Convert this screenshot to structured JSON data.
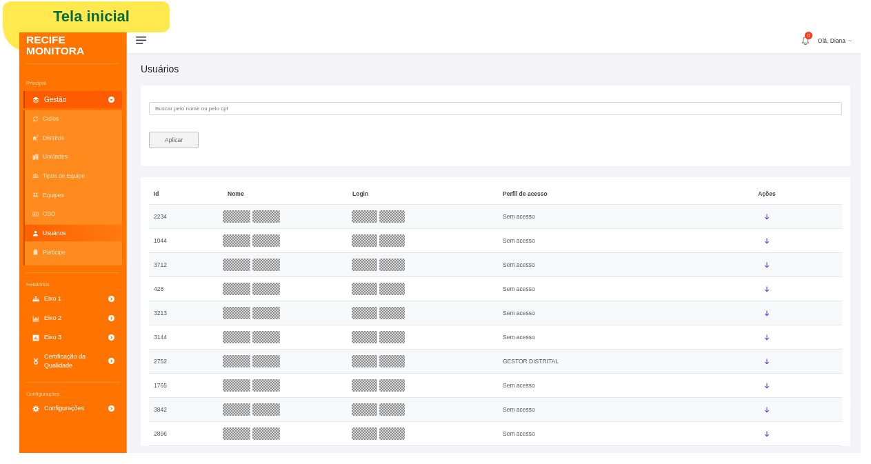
{
  "callout": {
    "text": "Tela inicial"
  },
  "sidebar": {
    "logo": "RECIFE MONITORA",
    "sections": [
      {
        "label": "Principal",
        "items": [
          {
            "label": "Gestão",
            "expanded": true,
            "children": [
              {
                "label": "Ciclos",
                "selected": false
              },
              {
                "label": "Distritos",
                "selected": false
              },
              {
                "label": "Unidades",
                "selected": false
              },
              {
                "label": "Tipos de Equipe",
                "selected": false
              },
              {
                "label": "Equipes",
                "selected": false
              },
              {
                "label": "CBO",
                "selected": false
              },
              {
                "label": "Usuários",
                "selected": true
              },
              {
                "label": "Participe",
                "selected": false
              }
            ]
          }
        ]
      },
      {
        "label": "Relatórios",
        "items": [
          {
            "label": "Eixo 1",
            "expanded": false
          },
          {
            "label": "Eixo 2",
            "expanded": false
          },
          {
            "label": "Eixo 3",
            "expanded": false
          },
          {
            "label": "Certificação da Qualidade",
            "expanded": false
          }
        ]
      },
      {
        "label": "Configurações",
        "items": [
          {
            "label": "Configurações",
            "expanded": false
          }
        ]
      }
    ]
  },
  "top_bar": {
    "notifications": {
      "badge": "0"
    },
    "user_menu": {
      "label": "Olá, Diana"
    }
  },
  "page_title": "Usuários",
  "filter": {
    "search": {
      "placeholder": "Buscar pelo nome ou pelo cpf"
    },
    "apply_button": "Aplicar"
  },
  "table": {
    "columns": [
      "Id",
      "Nome",
      "Login",
      "Perfil de acesso",
      "Ações"
    ],
    "rows": [
      {
        "id": "2234",
        "nome_redacted": true,
        "login_redacted": true,
        "perfil": "Sem acesso"
      },
      {
        "id": "1044",
        "nome_redacted": true,
        "login_redacted": true,
        "perfil": "Sem acesso"
      },
      {
        "id": "3712",
        "nome_redacted": true,
        "login_redacted": true,
        "perfil": "Sem acesso"
      },
      {
        "id": "428",
        "nome_redacted": true,
        "login_redacted": true,
        "perfil": "Sem acesso"
      },
      {
        "id": "3213",
        "nome_redacted": true,
        "login_redacted": true,
        "perfil": "Sem acesso"
      },
      {
        "id": "3144",
        "nome_redacted": true,
        "login_redacted": true,
        "perfil": "Sem acesso"
      },
      {
        "id": "2752",
        "nome_redacted": true,
        "login_redacted": true,
        "perfil": "GESTOR DISTRITAL"
      },
      {
        "id": "1765",
        "nome_redacted": true,
        "login_redacted": true,
        "perfil": "Sem acesso"
      },
      {
        "id": "3842",
        "nome_redacted": true,
        "login_redacted": true,
        "perfil": "Sem acesso"
      },
      {
        "id": "2896",
        "nome_redacted": true,
        "login_redacted": true,
        "perfil": "Sem acesso"
      }
    ]
  }
}
